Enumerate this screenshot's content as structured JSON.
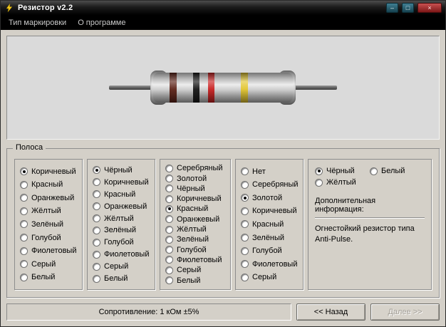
{
  "window": {
    "title": "Резистор v2.2",
    "buttons": {
      "minimize": "–",
      "maximize": "□",
      "close": "×"
    }
  },
  "menu": {
    "items": [
      {
        "label": "Тип маркировки"
      },
      {
        "label": "О программе"
      }
    ]
  },
  "resistor": {
    "bands": [
      {
        "name": "brown-band",
        "color": "#5e2318"
      },
      {
        "name": "black-band",
        "color": "#161616"
      },
      {
        "name": "red-band",
        "color": "#c92121"
      },
      {
        "name": "gold-band",
        "color": "#e2c52f"
      }
    ]
  },
  "band_group": {
    "label": "Полоса",
    "columns": [
      {
        "options": [
          "Коричневый",
          "Красный",
          "Оранжевый",
          "Жёлтый",
          "Зелёный",
          "Голубой",
          "Фиолетовый",
          "Серый",
          "Белый"
        ],
        "selected": 0
      },
      {
        "options": [
          "Чёрный",
          "Коричневый",
          "Красный",
          "Оранжевый",
          "Жёлтый",
          "Зелёный",
          "Голубой",
          "Фиолетовый",
          "Серый",
          "Белый"
        ],
        "selected": 0
      },
      {
        "options": [
          "Серебряный",
          "Золотой",
          "Чёрный",
          "Коричневый",
          "Красный",
          "Оранжевый",
          "Жёлтый",
          "Зелёный",
          "Голубой",
          "Фиолетовый",
          "Серый",
          "Белый"
        ],
        "selected": 4
      },
      {
        "options": [
          "Нет",
          "Серебряный",
          "Золотой",
          "Коричневый",
          "Красный",
          "Зелёный",
          "Голубой",
          "Фиолетовый",
          "Серый"
        ],
        "selected": 2
      },
      {
        "options": [
          "Чёрный",
          "Белый",
          "Жёлтый"
        ],
        "selected": 0
      }
    ]
  },
  "extra_info": {
    "label": "Дополнительная информация:",
    "text": "Огнестойкий резистор типа Anti-Pulse."
  },
  "footer": {
    "status": "Сопротивление: 1 кОм ±5%",
    "back_label": "<< Назад",
    "next_label": "Далее >>"
  }
}
